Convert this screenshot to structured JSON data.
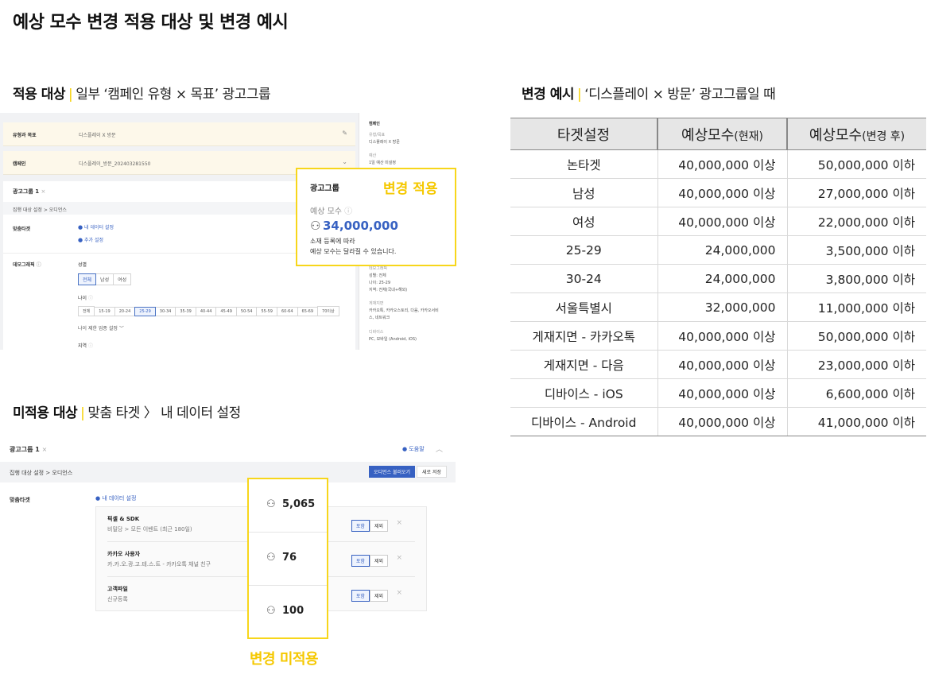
{
  "page_title": "예상 모수 변경 적용 대상 및 변경 예시",
  "section_apply": {
    "bold": "적용 대상",
    "divider": "|",
    "rest": "일부 ‘캠페인 유형 × 목표’ 광고그룹"
  },
  "section_example": {
    "bold": "변경 예시",
    "divider": "|",
    "rest": "‘디스플레이 × 방문’ 광고그룹일 때"
  },
  "section_not_apply": {
    "bold": "미적용 대상",
    "divider": "|",
    "rest": "맞춤 타겟 〉 내 데이터 설정"
  },
  "screenshot1": {
    "row1": {
      "key": "유형과 목표",
      "value": "디스플레이 X 방문"
    },
    "row2": {
      "key": "캠페인",
      "value": "디스플레이_방문_202403281550"
    },
    "adgroup_title": "광고그룹 1",
    "breadcrumb": "집행 대상 설정 > 오디언스",
    "custom_target_label": "맞춤타겟",
    "my_data_link": "내 데이터 설정",
    "add_setting_link": "추가 설정",
    "demographic_label": "데모그래픽",
    "gender_label": "성별",
    "gender_options": [
      "전체",
      "남성",
      "여성"
    ],
    "age_label": "나이",
    "age_options": [
      "전체",
      "15-19",
      "20-24",
      "25-29",
      "30-34",
      "35-39",
      "40-44",
      "45-49",
      "50-54",
      "55-59",
      "60-64",
      "65-69",
      "70이상"
    ],
    "age_limit_link": "나이 제한 업종 설정",
    "region_label": "지역",
    "side": {
      "campaign": "캠페인",
      "type_key": "유형/목표",
      "type_val": "디스플레이 X 방문",
      "budget_key": "예산",
      "budget_val": "1일 예산 미설정",
      "demo_key": "데모그래픽",
      "demo_gender": "성별: 전체",
      "demo_age": "나이: 25-29",
      "demo_region": "지역: 전체(국내+해외)",
      "place_key": "게재지면",
      "place_val1": "카카오톡, 카카오스토리, 다음, 카카오서비",
      "place_val2": "스, 네트워크",
      "device_key": "디바이스",
      "device_val": "PC, 모바일 (Android, iOS)"
    }
  },
  "highlight1": {
    "heading": "광고그룹",
    "tag": "변경 적용",
    "estimate_label": "예상 모수",
    "estimate_value": "34,000,000",
    "note_line1": "소재 등록에 따라",
    "note_line2": "예상 모수는 달라질 수 있습니다."
  },
  "screenshot2": {
    "adgroup_title": "광고그룹 1",
    "help_link": "도움말",
    "breadcrumb": "집행 대상 설정 > 오디언스",
    "load_audience_button": "오디언스 불러오기",
    "save_new_button": "새로 저장",
    "custom_target_label": "맞춤타겟",
    "my_data_link": "내 데이터 설정",
    "include_label": "포함",
    "exclude_label": "제외",
    "items": [
      {
        "name": "픽셀 & SDK",
        "detail": "비밀당 > 모든 이벤트 (최근 180일)"
      },
      {
        "name": "카카오 사용자",
        "detail": "카.카.오.광.고.테.스.트 - 카카오톡 채널 친구"
      },
      {
        "name": "고객파일",
        "detail": "신규등록"
      }
    ]
  },
  "highlight2": {
    "values": [
      "5,065",
      "76",
      "100"
    ],
    "label": "변경 미적용"
  },
  "table": {
    "headers": [
      {
        "main": "타겟설정",
        "sub": ""
      },
      {
        "main": "예상모수",
        "sub": "(현재)"
      },
      {
        "main": "예상모수",
        "sub": "(변경 후)"
      }
    ],
    "rows": [
      [
        "논타겟",
        "40,000,000 이상",
        "50,000,000 이하"
      ],
      [
        "남성",
        "40,000,000 이상",
        "27,000,000 이하"
      ],
      [
        "여성",
        "40,000,000 이상",
        "22,000,000 이하"
      ],
      [
        "25-29",
        "24,000,000",
        "3,500,000 이하"
      ],
      [
        "30-24",
        "24,000,000",
        "3,800,000 이하"
      ],
      [
        "서울특별시",
        "32,000,000",
        "11,000,000 이하"
      ],
      [
        "게재지면 - 카카오톡",
        "40,000,000 이상",
        "50,000,000 이하"
      ],
      [
        "게재지면 - 다음",
        "40,000,000 이상",
        "23,000,000 이하"
      ],
      [
        "디바이스 - iOS",
        "40,000,000 이상",
        "6,600,000 이하"
      ],
      [
        "디바이스 - Android",
        "40,000,000 이상",
        "41,000,000 이하"
      ]
    ]
  },
  "colors": {
    "highlight": "#f7d61b",
    "accent_blue": "#3761c2"
  },
  "icons": [
    "person-icon",
    "pencil-icon",
    "chevron-down-icon",
    "help-circle-icon",
    "plus-circle-icon",
    "close-icon",
    "info-icon",
    "chevron-up-icon"
  ]
}
